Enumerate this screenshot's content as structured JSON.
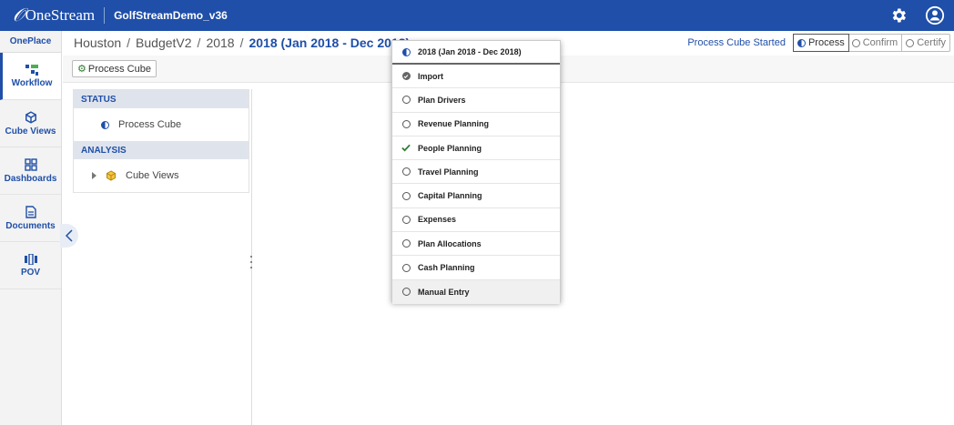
{
  "topbar": {
    "logo_text": "OneStream",
    "app_name": "GolfStreamDemo_v36",
    "icons": [
      "gear-icon",
      "user-icon"
    ]
  },
  "nav": {
    "oneplace": "OnePlace",
    "items": [
      {
        "label": "Workflow",
        "icon": "workflow-icon"
      },
      {
        "label": "Cube Views",
        "icon": "cube-icon"
      },
      {
        "label": "Dashboards",
        "icon": "dashboards-icon"
      },
      {
        "label": "Documents",
        "icon": "document-icon"
      },
      {
        "label": "POV",
        "icon": "pov-icon"
      }
    ]
  },
  "breadcrumb": {
    "parts": [
      "Houston",
      "BudgetV2",
      "2018"
    ],
    "separator": "/",
    "current": "2018 (Jan 2018 - Dec 2018)"
  },
  "status": {
    "text": "Process Cube Started",
    "steps": [
      {
        "label": "Process",
        "active": true
      },
      {
        "label": "Confirm",
        "active": false
      },
      {
        "label": "Certify",
        "active": false
      }
    ]
  },
  "toolbar": {
    "process_cube_label": "Process Cube"
  },
  "panel": {
    "status_header": "STATUS",
    "status_item": "Process Cube",
    "analysis_header": "ANALYSIS",
    "analysis_item": "Cube Views"
  },
  "dropdown": {
    "header": "2018 (Jan 2018 - Dec 2018)",
    "items": [
      {
        "label": "Import",
        "state": "completed"
      },
      {
        "label": "Plan Drivers",
        "state": "empty"
      },
      {
        "label": "Revenue Planning",
        "state": "empty"
      },
      {
        "label": "People Planning",
        "state": "check"
      },
      {
        "label": "Travel Planning",
        "state": "empty"
      },
      {
        "label": "Capital Planning",
        "state": "empty"
      },
      {
        "label": "Expenses",
        "state": "empty"
      },
      {
        "label": "Plan Allocations",
        "state": "empty"
      },
      {
        "label": "Cash Planning",
        "state": "empty"
      },
      {
        "label": "Manual Entry",
        "state": "empty"
      }
    ]
  },
  "colors": {
    "brand": "#1f4fa8",
    "check": "#2e7d32"
  }
}
